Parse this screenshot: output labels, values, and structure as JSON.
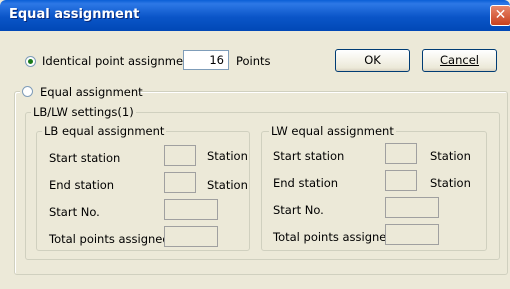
{
  "window": {
    "title": "Equal assignment",
    "close_label": "✕"
  },
  "identical": {
    "label": "Identical point assignment",
    "value": "16",
    "unit": "Points",
    "selected": true
  },
  "buttons": {
    "ok_label": "OK",
    "cancel_label": "Cancel"
  },
  "equal": {
    "label": "Equal assignment",
    "selected": false
  },
  "lblw": {
    "group_label": "LB/LW settings(1)",
    "lb": {
      "group_label": "LB equal assignment",
      "start_station": "Start station",
      "end_station": "End station",
      "station_unit": "Station",
      "start_no": "Start No.",
      "total_points": "Total points assigned"
    },
    "lw": {
      "group_label": "LW equal assignment",
      "start_station": "Start station",
      "end_station": "End station",
      "station_unit": "Station",
      "start_no": "Start No.",
      "total_points": "Total points assigned"
    }
  }
}
